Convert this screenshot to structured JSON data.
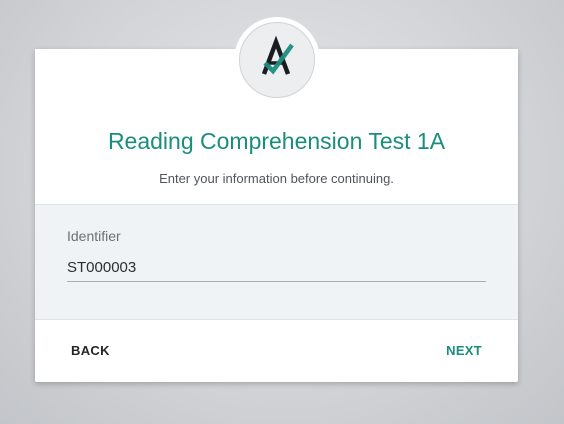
{
  "header": {
    "logo_icon": "brand-logo-a-check-icon",
    "title": "Reading Comprehension Test 1A",
    "subtitle": "Enter your information before continuing."
  },
  "form": {
    "identifier_label": "Identifier",
    "identifier_value": "ST000003"
  },
  "actions": {
    "back_label": "BACK",
    "next_label": "NEXT"
  },
  "colors": {
    "accent": "#1b8d7f",
    "background": "#d3d5d8",
    "card": "#ffffff",
    "form_section": "#eff3f5",
    "text_dark": "#222629"
  }
}
